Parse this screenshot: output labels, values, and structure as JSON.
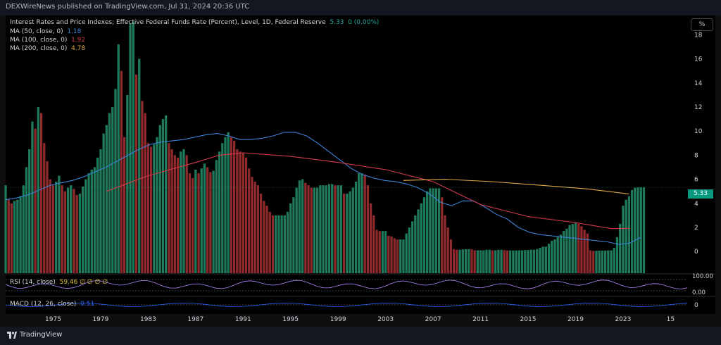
{
  "header": {
    "published": "DEXWireNews published on TradingView.com, Jul 31, 2024 20:36 UTC"
  },
  "legend": {
    "main_title": "Interest Rates and Price Indexes; Effective Federal Funds Rate (Percent), Level, 1D, Federal Reserve",
    "main_value": "5.33",
    "main_change": "0 (0.00%)",
    "ma50_label": "MA (50, close, 0)",
    "ma50_value": "1.18",
    "ma100_label": "MA (100, close, 0)",
    "ma100_value": "1.92",
    "ma200_label": "MA (200, close, 0)",
    "ma200_value": "4.78",
    "rsi_label": "RSI (14, close)",
    "rsi_values": "59.46  ∅  ∅  ∅  ∅",
    "macd_label": "MACD (12, 26, close)",
    "macd_value": "0.51"
  },
  "scale_button": "%",
  "last_price": "5.33",
  "footer": {
    "brand": "TradingView"
  },
  "colors": {
    "up": "#1f7a5c",
    "down": "#8f2a2c",
    "ma50": "#3b82d6",
    "ma100": "#d23b4c",
    "ma200": "#e0a84a",
    "rsi": "#b388ff",
    "macd": "#2962ff"
  },
  "chart_data": {
    "type": "bar",
    "title": "Interest Rates and Price Indexes; Effective Federal Funds Rate (Percent), Level, 1D, Federal Reserve",
    "x_start": 1971.0,
    "x_step": 0.25,
    "values": [
      5.5,
      4.3,
      4.0,
      4.2,
      4.3,
      4.6,
      5.5,
      7.0,
      8.5,
      10.8,
      10.2,
      12.0,
      11.5,
      9.0,
      7.5,
      6.0,
      5.5,
      5.8,
      6.3,
      5.5,
      5.0,
      5.3,
      5.5,
      5.2,
      4.7,
      4.8,
      5.4,
      6.0,
      6.5,
      6.8,
      7.0,
      7.8,
      8.5,
      9.8,
      10.5,
      11.5,
      12.0,
      13.5,
      17.2,
      15.0,
      9.5,
      13.0,
      18.9,
      19.1,
      14.7,
      16.0,
      12.5,
      11.5,
      9.0,
      8.7,
      8.9,
      9.5,
      10.5,
      11.0,
      11.3,
      9.0,
      8.5,
      8.0,
      7.8,
      8.3,
      8.5,
      8.0,
      6.5,
      6.1,
      6.8,
      6.5,
      6.9,
      7.3,
      7.0,
      6.6,
      6.7,
      7.6,
      8.3,
      9.0,
      9.5,
      9.9,
      9.5,
      9.2,
      8.5,
      8.3,
      8.2,
      7.8,
      6.9,
      6.2,
      5.8,
      5.5,
      4.8,
      4.2,
      3.8,
      3.3,
      3.0,
      3.0,
      3.0,
      3.0,
      3.0,
      3.3,
      4.0,
      4.5,
      5.3,
      5.9,
      6.0,
      5.7,
      5.5,
      5.3,
      5.3,
      5.3,
      5.5,
      5.5,
      5.5,
      5.6,
      5.6,
      5.5,
      5.5,
      5.5,
      4.8,
      4.8,
      5.0,
      5.3,
      5.8,
      6.5,
      6.5,
      6.4,
      5.5,
      4.0,
      3.0,
      1.8,
      1.7,
      1.7,
      1.7,
      1.3,
      1.25,
      1.1,
      1.0,
      1.0,
      1.0,
      1.5,
      2.0,
      2.5,
      3.0,
      3.5,
      4.0,
      4.5,
      5.0,
      5.25,
      5.25,
      5.25,
      5.25,
      4.5,
      3.0,
      2.0,
      1.0,
      0.2,
      0.15,
      0.15,
      0.18,
      0.2,
      0.2,
      0.18,
      0.1,
      0.1,
      0.1,
      0.1,
      0.15,
      0.15,
      0.1,
      0.1,
      0.14,
      0.14,
      0.12,
      0.09,
      0.09,
      0.09,
      0.1,
      0.1,
      0.1,
      0.12,
      0.13,
      0.15,
      0.15,
      0.2,
      0.3,
      0.4,
      0.4,
      0.65,
      0.9,
      1.0,
      1.2,
      1.4,
      1.7,
      1.9,
      2.2,
      2.3,
      2.4,
      2.3,
      2.1,
      1.8,
      1.5,
      0.1,
      0.05,
      0.06,
      0.08,
      0.08,
      0.08,
      0.1,
      0.1,
      0.3,
      1.2,
      2.3,
      3.8,
      4.3,
      4.6,
      5.1,
      5.3,
      5.33,
      5.33,
      5.33
    ],
    "ma50": [
      4.3,
      4.45,
      4.7,
      5.1,
      5.5,
      5.7,
      5.9,
      6.2,
      6.6,
      7.0,
      7.5,
      8.0,
      8.5,
      8.9,
      9.1,
      9.2,
      9.3,
      9.5,
      9.7,
      9.8,
      9.6,
      9.3,
      9.3,
      9.4,
      9.6,
      9.9,
      9.9,
      9.6,
      9.0,
      8.3,
      7.6,
      6.9,
      6.4,
      6.1,
      5.9,
      5.8,
      5.6,
      5.3,
      4.8,
      4.1,
      3.8,
      4.2,
      4.2,
      3.7,
      3.1,
      2.7,
      2.0,
      1.6,
      1.4,
      1.3,
      1.2,
      1.1,
      1.0,
      0.9,
      0.8,
      0.6,
      0.7,
      1.18
    ],
    "ma100": [
      null,
      null,
      null,
      null,
      null,
      null,
      null,
      null,
      null,
      null,
      null,
      null,
      null,
      null,
      null,
      null,
      null,
      null,
      null,
      null,
      null,
      null,
      null,
      null,
      null,
      null,
      null,
      null,
      null,
      null,
      null,
      null,
      null,
      null,
      null,
      null,
      null,
      null,
      null,
      null,
      null,
      null,
      null,
      null,
      null,
      null,
      null,
      null,
      null,
      null,
      null,
      null,
      null,
      null,
      null,
      null,
      null,
      null,
      null,
      null,
      null,
      null,
      null,
      null,
      null,
      null,
      null,
      null,
      null,
      null,
      null,
      null,
      null,
      null,
      null,
      null,
      null,
      null,
      null,
      null,
      null,
      null,
      null,
      null,
      null,
      null,
      null,
      null,
      null,
      null,
      null,
      null,
      null,
      null,
      null,
      null,
      null,
      null,
      null,
      null,
      null,
      null,
      null,
      null,
      null,
      null,
      null,
      null,
      null,
      null,
      null,
      null,
      null,
      null,
      null,
      null,
      null,
      null,
      null,
      null,
      null,
      null,
      null,
      null,
      null,
      null,
      null,
      null,
      null,
      null,
      null,
      null,
      null,
      null,
      null,
      null,
      null,
      null,
      null,
      null,
      null,
      null,
      null,
      null,
      null,
      null,
      null,
      null,
      null,
      null,
      null,
      null,
      null,
      null,
      null,
      null,
      null,
      null,
      null,
      null,
      null,
      null,
      null,
      null,
      null,
      null,
      null,
      null,
      null,
      null,
      null,
      null,
      null,
      null,
      null,
      null,
      null,
      null,
      null,
      null,
      null,
      null,
      null,
      null,
      null,
      null,
      null,
      null,
      null,
      null,
      null,
      null,
      null,
      null,
      null,
      null,
      null,
      null,
      null,
      null,
      null,
      null,
      null,
      null,
      null,
      null,
      null,
      null,
      null,
      null,
      null,
      null,
      null,
      null,
      null,
      null,
      null
    ],
    "ma100_pts": [
      [
        1979.5,
        5.0
      ],
      [
        1983,
        6.3
      ],
      [
        1987,
        7.4
      ],
      [
        1989,
        8.0
      ],
      [
        1991,
        8.2
      ],
      [
        1995,
        7.9
      ],
      [
        1999,
        7.4
      ],
      [
        2003,
        6.8
      ],
      [
        2007,
        5.8
      ],
      [
        2011,
        3.9
      ],
      [
        2015,
        2.9
      ],
      [
        2019,
        2.4
      ],
      [
        2022,
        1.9
      ],
      [
        2023.5,
        1.92
      ]
    ],
    "ma200_pts": [
      [
        2004.5,
        5.9
      ],
      [
        2008,
        6.0
      ],
      [
        2012,
        5.8
      ],
      [
        2016,
        5.5
      ],
      [
        2020,
        5.2
      ],
      [
        2023.5,
        4.78
      ]
    ],
    "x_ticks": [
      "1975",
      "1979",
      "1983",
      "1987",
      "1991",
      "1995",
      "1999",
      "2003",
      "2007",
      "2011",
      "2015",
      "2019",
      "2023",
      "15"
    ],
    "x_tick_years": [
      1975,
      1979,
      1983,
      1987,
      1991,
      1995,
      1999,
      2003,
      2007,
      2011,
      2015,
      2019,
      2023,
      2027
    ],
    "y_ticks": [
      0,
      2,
      4,
      6,
      8,
      10,
      12,
      14,
      16,
      18
    ],
    "ylim": [
      -1.8,
      19.6
    ],
    "xlim": [
      1971,
      2028.4
    ],
    "rsi_ticks": [
      "100.00",
      "0.00"
    ],
    "macd_ticks": [
      "0"
    ]
  }
}
